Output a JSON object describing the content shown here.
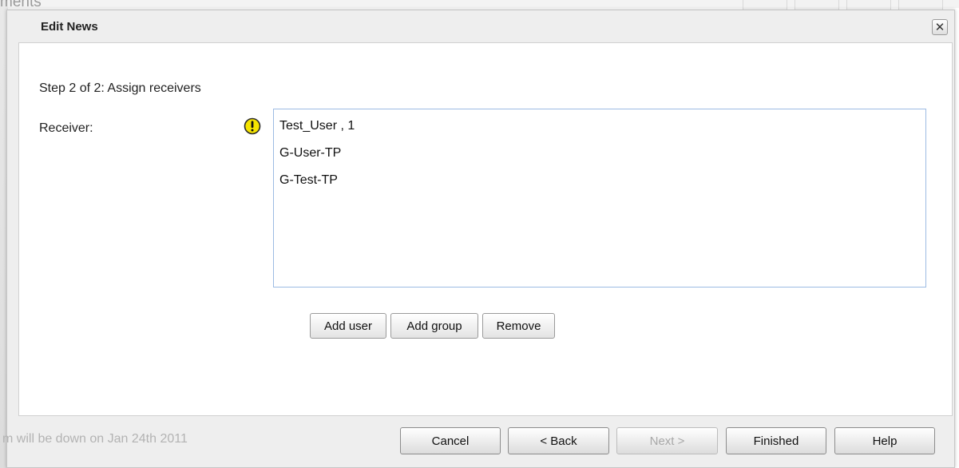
{
  "background": {
    "top_text": "ments",
    "status_text": "m will be down on Jan 24th 2011"
  },
  "dialog": {
    "title": "Edit News",
    "close_glyph": "✕"
  },
  "content": {
    "step_label": "Step 2 of 2: Assign receivers",
    "receiver_label": "Receiver:",
    "warning_icon": "warning-icon",
    "receivers": [
      "Test_User , 1",
      "G-User-TP",
      "G-Test-TP"
    ]
  },
  "actions": {
    "add_user": "Add user",
    "add_group": "Add group",
    "remove": "Remove"
  },
  "footer": {
    "cancel": "Cancel",
    "back": "< Back",
    "next": "Next >",
    "finished": "Finished",
    "help": "Help"
  },
  "colors": {
    "warning": "#f5e400",
    "list_border": "#9dbbe3",
    "dialog_bg": "#eeeeee"
  }
}
